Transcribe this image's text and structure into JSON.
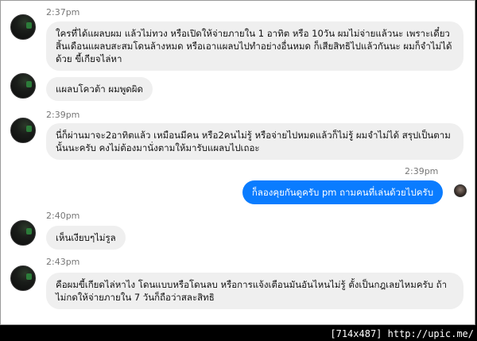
{
  "messages": [
    {
      "time": "2:37pm",
      "text": "ใครที่ได้แผลบผม แล้วไม่ทวง หรือเปิดให้จ่ายภายใน 1 อาทิต หรือ 10วัน ผมไม่จ่ายแล้วนะ เพราะเดี๋ยวสิ้นเดือนแผลบสะสมโดนล้างหมด หรือเอาแผลบไปทำอย่างอื่นหมด ก็เสียสิทธิไปแล้วกันนะ ผมก็จำไม่ได้ด้วย ขี้เกียจไล่หา"
    },
    {
      "time": "",
      "text": "แผลบโควต้า ผมพูดผิด"
    },
    {
      "time": "2:39pm",
      "text": "นี่ก็ผ่านมาจะ2อาทิตแล้ว เหมือนมีคน หรือ2คนไม่รู้ หรือจ่ายไปหมดแล้วก็ไม่รู้ ผมจำไม่ได้ สรุปเป็นตามนั้นนะครับ คงไม่ต้องมานั่งตามให้มารับแผลบไปเถอะ"
    },
    {
      "time": "2:39pm",
      "text": "ก็ลองคุยกันดูครับ pm ถามคนที่เล่นด้วยไปครับ",
      "mine": true
    },
    {
      "time": "2:40pm",
      "text": "เห็นเงียบๆไม่รูล"
    },
    {
      "time": "2:43pm",
      "text": "คือผมขี้เกียดไล่หาไง โดนแบบหรือโดนลบ หรือการแจ้งเตือนมันอันไหนไม่รู้ ตั้งเป็นกฎเลยไหมครับ ถ้าไม่กดให้จ่ายภายใน 7 วันก็ถือว่าสละสิทธิ"
    }
  ],
  "footer": "[714x487] http://upic.me/"
}
